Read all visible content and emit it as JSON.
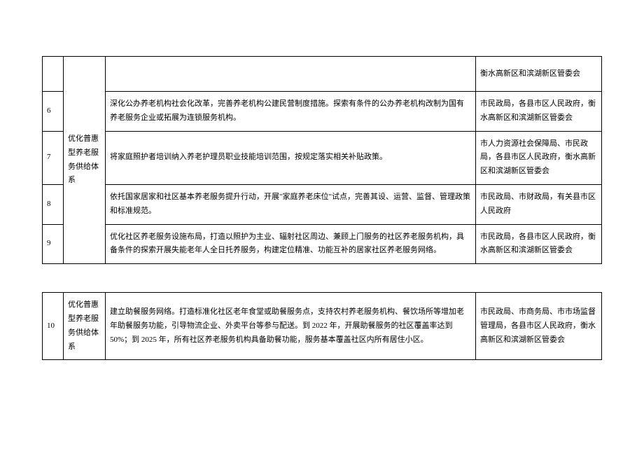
{
  "table1": {
    "category": "优化普惠型养老服务供给体系",
    "rows": [
      {
        "num": "",
        "content": "",
        "dept": "衡水高新区和滨湖新区管委会"
      },
      {
        "num": "6",
        "content": "深化公办养老机构社会化改革，完善养老机构公建民营制度措施。探索有条件的公办养老机构改制为国有养老服务企业或拓展为连锁服务机构。",
        "dept": "市民政局，各县市区人民政府，衡水高新区和滨湖新区管委会"
      },
      {
        "num": "7",
        "content": "将家庭照护者培训纳入养老护理员职业技能培训范围，按规定落实相关补贴政策。",
        "dept": "市人力资源社会保障局、市民政局，各县市区人民政府，衡水高新区和滨湖新区管委会"
      },
      {
        "num": "8",
        "content": "依托国家居家和社区基本养老服务提升行动，开展\"家庭养老床位\"试点，完善其设、运营、监督、管理政策和标准规范。",
        "dept": "市民政局、市财政局，有关县市区人民政府"
      },
      {
        "num": "9",
        "content": "优化社区养老服务设施布局，打造以照护为主业、辐射社区周边、兼顾上门服务的社区养老服务机构，具备条件的探索开展失能老年人全日托养服务，构建定位精准、功能互补的居家社区养老服务网络。",
        "dept": "市民政局，各县市区人民政府，衡水高新区和滨湖新区管委会"
      }
    ]
  },
  "table2": {
    "category": "优化普惠型养老服务供给体系",
    "rows": [
      {
        "num": "10",
        "content": "建立助餐服务网络。打造标准化社区老年食堂或助餐服务点，支持农村养老服务机构、餐饮场所等增加老年助餐服务功能，引导物流企业、外卖平台等参与配送。到 2022 年，开展助餐服务的社区覆盖率达到 50%；到 2025 年，所有社区养老服务机构具备助餐功能，服务基本覆盖社区内所有居住小区。",
        "dept": "市民政局、市商务局、市市场监督管理局，各县市区人民政府，衡水高新区和滨湖新区管委会"
      }
    ]
  }
}
